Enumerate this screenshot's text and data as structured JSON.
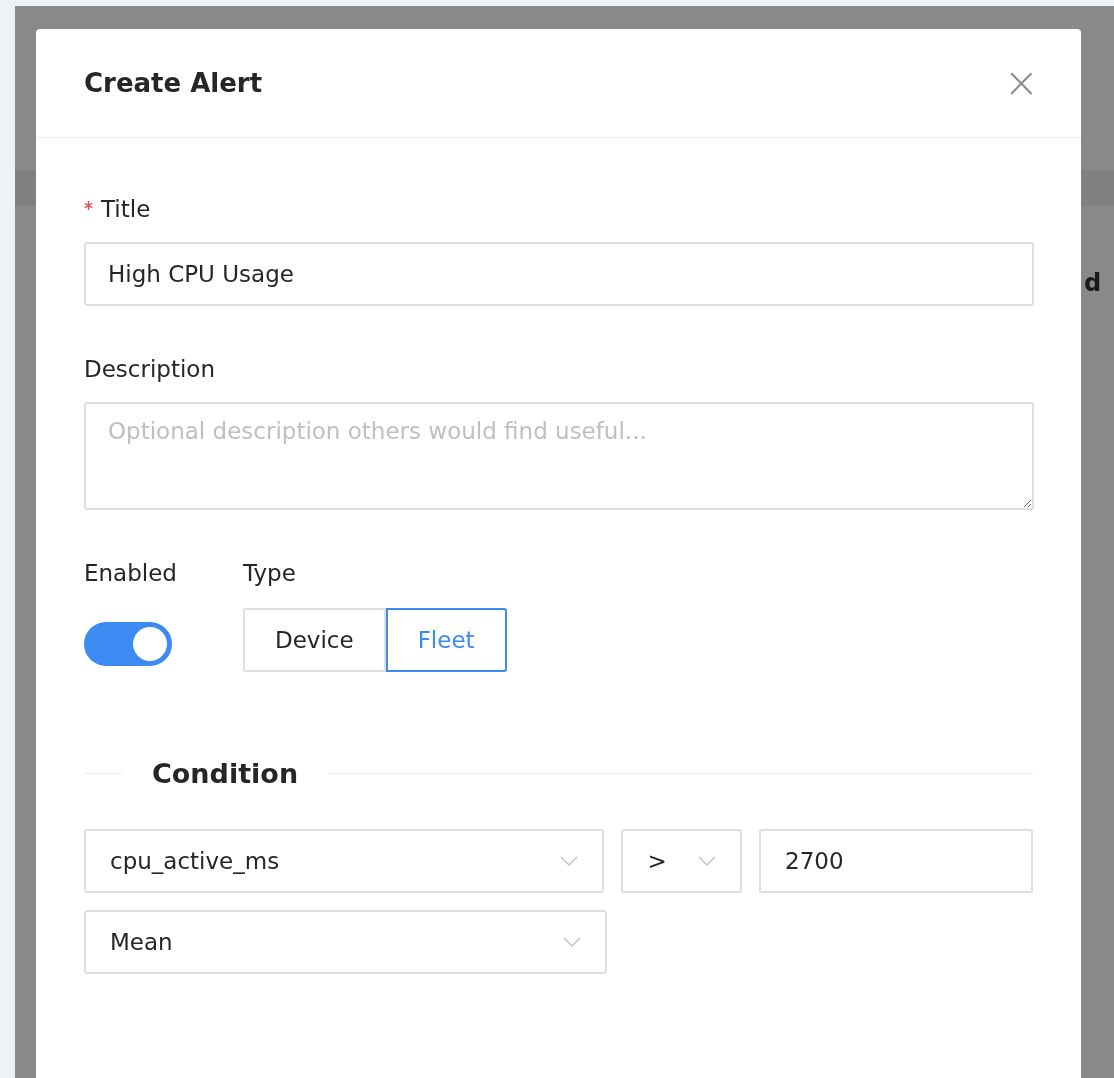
{
  "background_page": {
    "visible_text": "d"
  },
  "dialog": {
    "title": "Create Alert",
    "close_icon": "×",
    "fields": [
      {
        "kind": "input",
        "label": "Title",
        "required": true,
        "value": "High CPU Usage"
      },
      {
        "kind": "textarea",
        "label": "Description",
        "required": false,
        "placeholder": "Optional description others would find useful..."
      }
    ],
    "enabled": {
      "label": "Enabled",
      "on": true
    },
    "type": {
      "label": "Type",
      "options": [
        {
          "label": "Device",
          "selected": false
        },
        {
          "label": "Fleet",
          "selected": true
        }
      ]
    },
    "condition": {
      "heading": "Condition",
      "rows": [
        [
          {
            "kind": "select",
            "value": "cpu_active_ms"
          },
          {
            "kind": "select",
            "value": ">"
          },
          {
            "kind": "input",
            "value": "2700"
          }
        ],
        [
          {
            "kind": "select",
            "value": "Mean"
          }
        ]
      ]
    }
  }
}
